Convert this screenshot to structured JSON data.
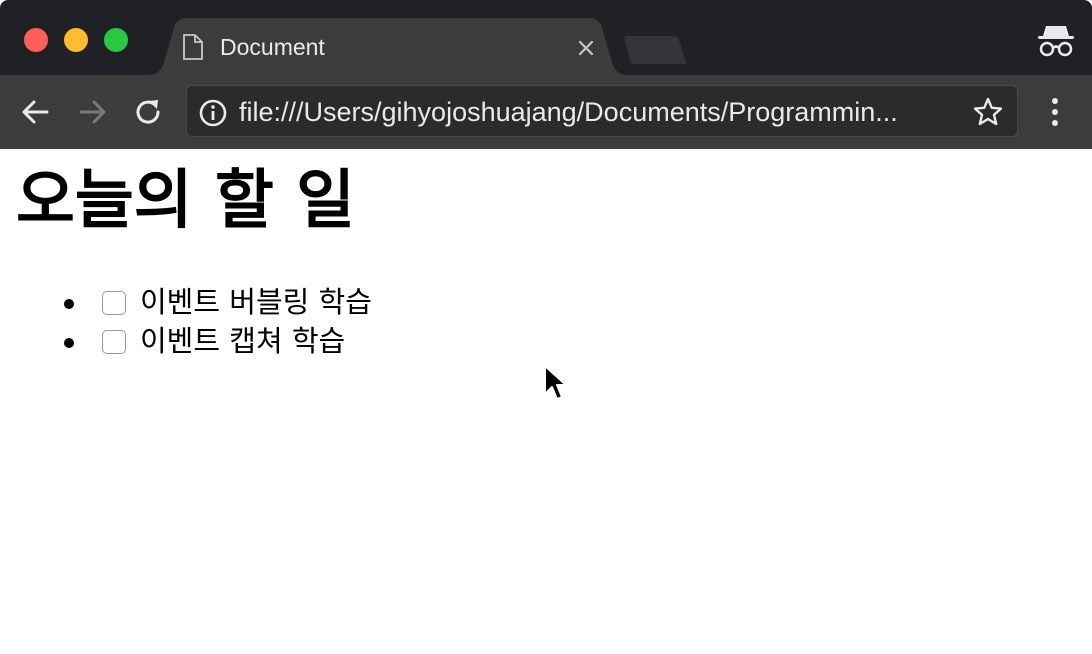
{
  "browser": {
    "tab": {
      "title": "Document"
    },
    "toolbar": {
      "url": "file:///Users/gihyojoshuajang/Documents/Programmin..."
    }
  },
  "page": {
    "heading": "오늘의 할 일",
    "todos": [
      {
        "label": "이벤트 버블링 학습",
        "checked": false
      },
      {
        "label": "이벤트 캡쳐 학습",
        "checked": false
      }
    ]
  },
  "colors": {
    "tabstrip": "#202124",
    "toolbar": "#3c3c3c",
    "close_red": "#fe5f57",
    "minimize_yellow": "#febc2e",
    "zoom_green": "#28c840"
  },
  "icons": {
    "tab": "document-icon",
    "incognito": "incognito-icon",
    "back": "arrow-left-icon",
    "forward": "arrow-right-icon",
    "reload": "reload-icon",
    "info": "info-icon",
    "bookmark": "star-icon",
    "menu": "kebab-menu-icon"
  }
}
